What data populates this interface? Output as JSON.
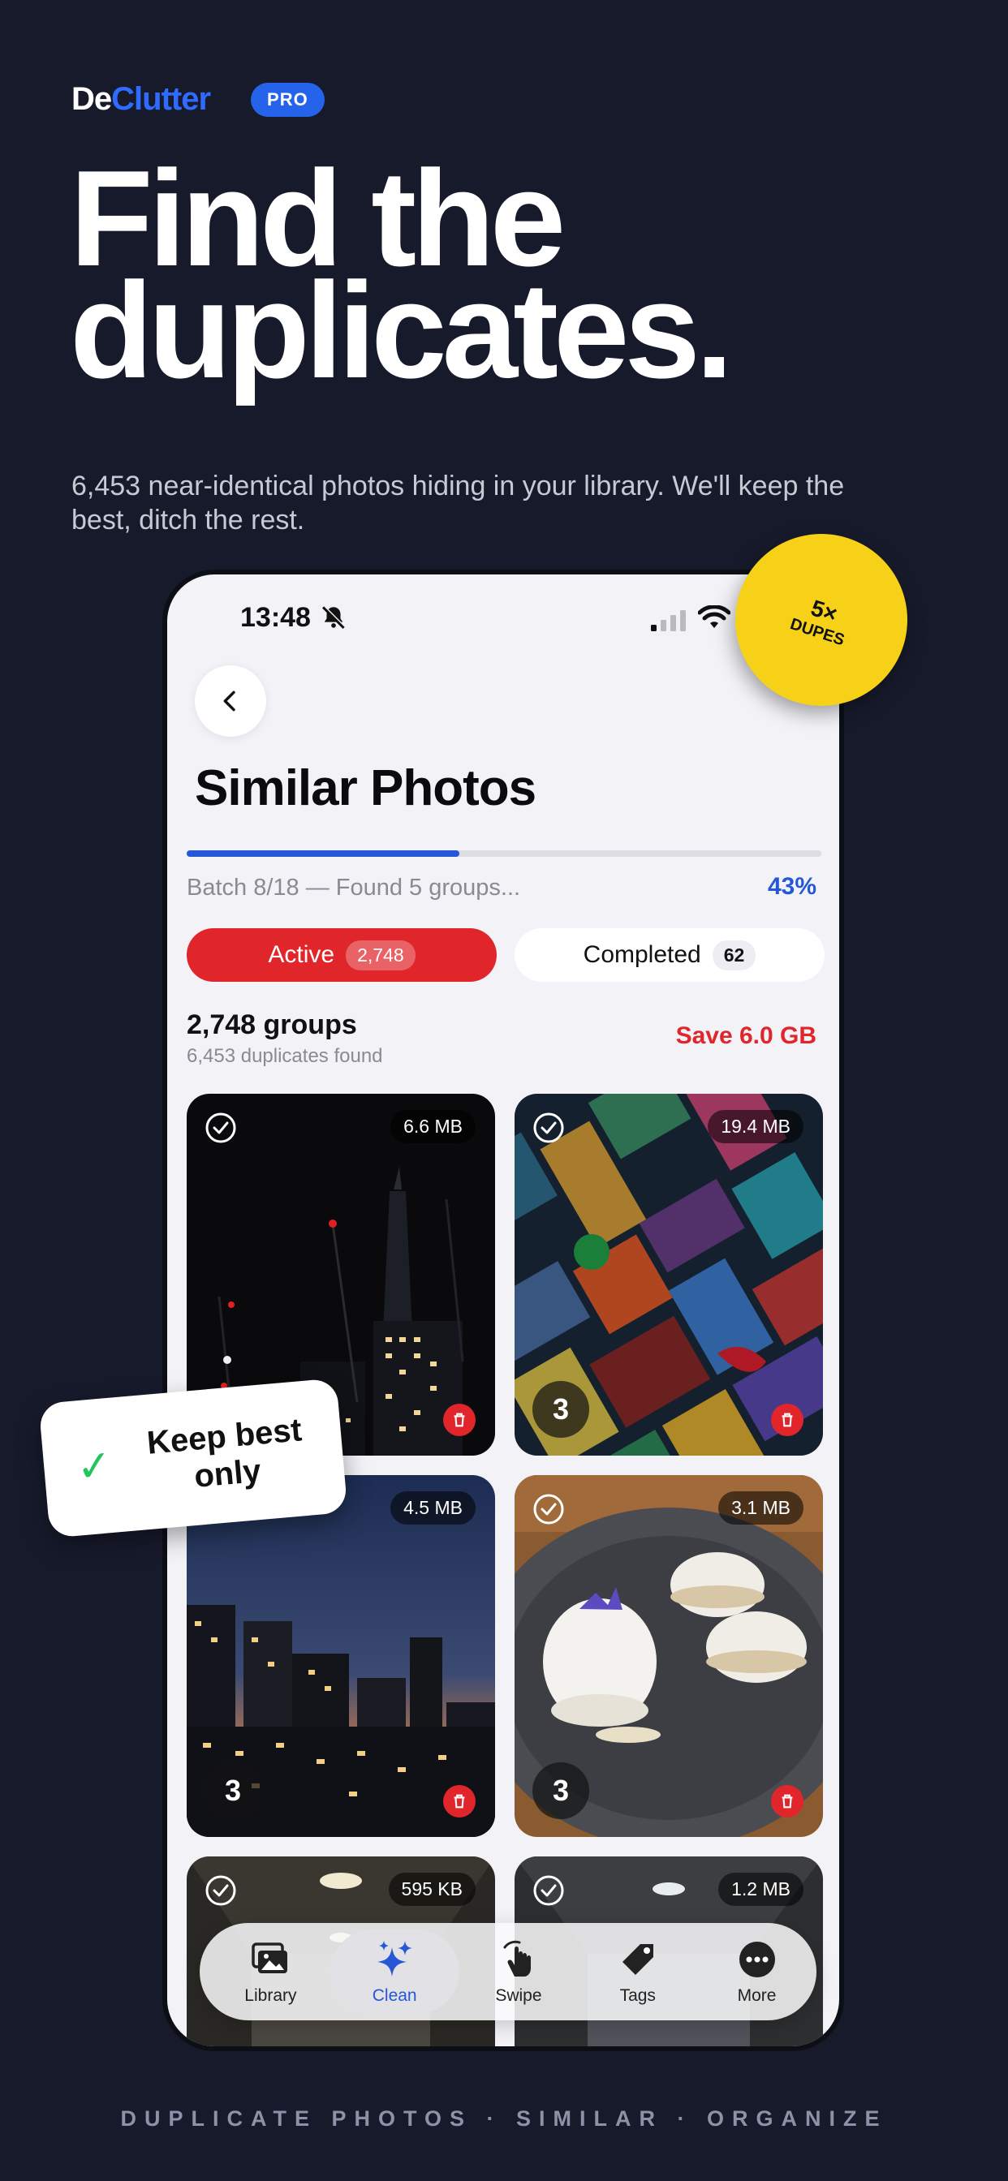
{
  "brand": {
    "logo_prefix": "De",
    "logo_suffix": "Clutter",
    "badge": "PRO"
  },
  "hero": {
    "headline_line1": "Find the",
    "headline_line2": "duplicates.",
    "subtitle": "6,453 near-identical photos hiding in your library. We'll keep the best, ditch the rest."
  },
  "phone": {
    "status": {
      "time": "13:48"
    },
    "title": "Similar Photos",
    "progress": {
      "fraction": 0.43,
      "text": "Batch 8/18 — Found 5 groups...",
      "percent": "43%"
    },
    "tabs": [
      {
        "label": "Active",
        "count": "2,748"
      },
      {
        "label": "Completed",
        "count": "62"
      }
    ],
    "summary": {
      "groups": "2,748 groups",
      "duplicates": "6,453 duplicates found",
      "save": "Save 6.0 GB"
    },
    "cards": [
      {
        "size": "6.6 MB",
        "count": ""
      },
      {
        "size": "19.4 MB",
        "count": "3"
      },
      {
        "size": "4.5 MB",
        "count": "3"
      },
      {
        "size": "3.1 MB",
        "count": "3"
      },
      {
        "size": "595 KB",
        "count": ""
      },
      {
        "size": "1.2 MB",
        "count": ""
      }
    ],
    "nav": [
      {
        "label": "Library",
        "icon": "photos-icon"
      },
      {
        "label": "Clean",
        "icon": "sparkles-icon"
      },
      {
        "label": "Swipe",
        "icon": "hand-swipe-icon"
      },
      {
        "label": "Tags",
        "icon": "tag-icon"
      },
      {
        "label": "More",
        "icon": "more-icon"
      }
    ]
  },
  "stickers": {
    "dupes_big": "5×",
    "dupes_small": "DUPES",
    "keep_line1": "Keep best",
    "keep_line2": "only"
  },
  "footer": {
    "tagline": "DUPLICATE PHOTOS · SIMILAR · ORGANIZE"
  },
  "colors": {
    "background": "#171a2b",
    "accent_blue": "#2557d6",
    "accent_red": "#e0262b",
    "sticker_yellow": "#f7d117"
  }
}
